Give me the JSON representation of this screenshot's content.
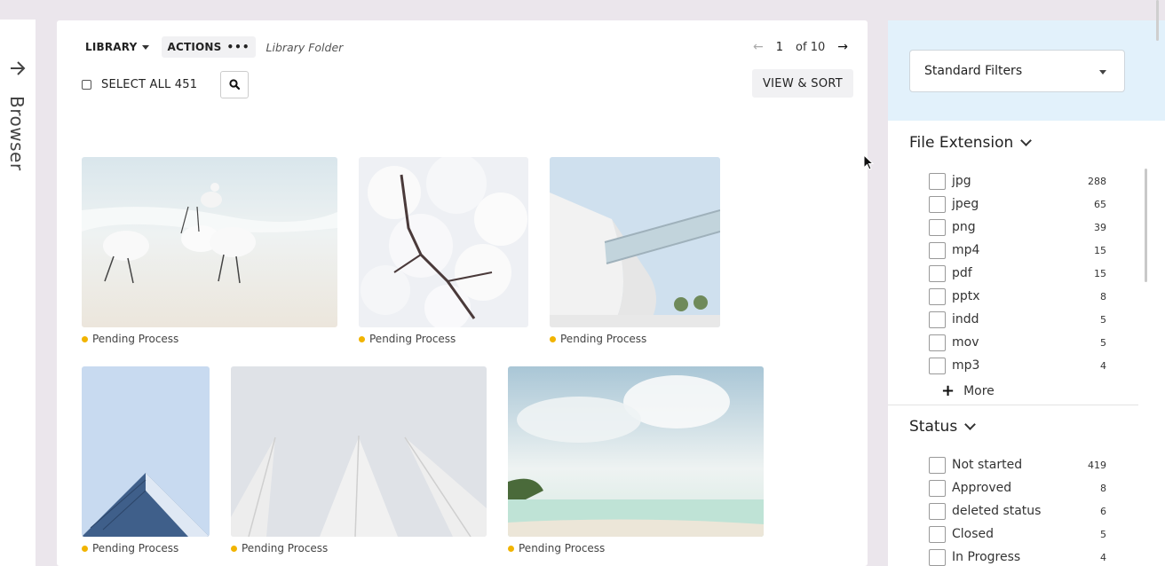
{
  "rail": {
    "label": "Browser",
    "icon": "arrow-right-icon"
  },
  "toolbar": {
    "library_label": "LIBRARY",
    "actions_label": "ACTIONS",
    "folder_label": "Library Folder",
    "select_all_label": "SELECT ALL 451",
    "view_sort_label": "VIEW & SORT"
  },
  "pager": {
    "current": "1",
    "of_label": "of 10"
  },
  "assets": [
    {
      "status": "Pending Process",
      "subject": "egrets"
    },
    {
      "status": "Pending Process",
      "subject": "blossoms"
    },
    {
      "status": "Pending Process",
      "subject": "building"
    },
    {
      "status": "Pending Process",
      "subject": "facade"
    },
    {
      "status": "Pending Process",
      "subject": "tent"
    },
    {
      "status": "Pending Process",
      "subject": "beach"
    }
  ],
  "filters": {
    "preset_label": "Standard Filters",
    "file_extension": {
      "title": "File Extension",
      "options": [
        {
          "label": "jpg",
          "count": "288"
        },
        {
          "label": "jpeg",
          "count": "65"
        },
        {
          "label": "png",
          "count": "39"
        },
        {
          "label": "mp4",
          "count": "15"
        },
        {
          "label": "pdf",
          "count": "15"
        },
        {
          "label": "pptx",
          "count": "8"
        },
        {
          "label": "indd",
          "count": "5"
        },
        {
          "label": "mov",
          "count": "5"
        },
        {
          "label": "mp3",
          "count": "4"
        }
      ],
      "more_label": "More"
    },
    "status": {
      "title": "Status",
      "options": [
        {
          "label": "Not started",
          "count": "419"
        },
        {
          "label": "Approved",
          "count": "8"
        },
        {
          "label": "deleted status",
          "count": "6"
        },
        {
          "label": "Closed",
          "count": "5"
        },
        {
          "label": "In Progress",
          "count": "4"
        }
      ]
    }
  },
  "colors": {
    "pending": "#f1b400",
    "filter_header_bg": "#e2f1fb"
  }
}
